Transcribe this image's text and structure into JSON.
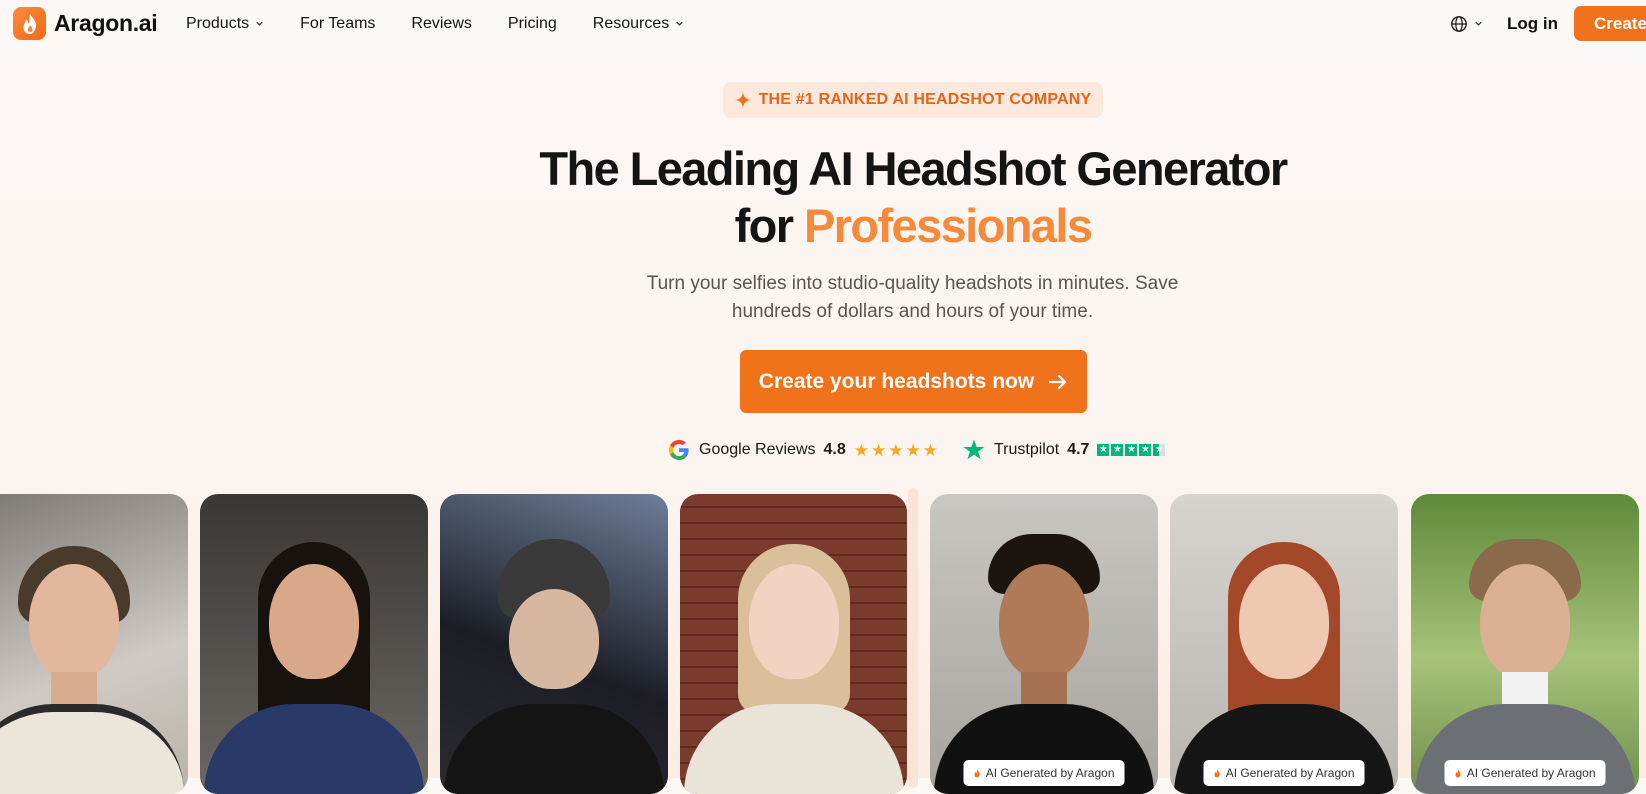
{
  "brand": {
    "name": "Aragon.ai",
    "color": "#f0731b",
    "accent_text": "#f58a3a"
  },
  "nav": {
    "items": [
      {
        "label": "Products",
        "dropdown": true
      },
      {
        "label": "For Teams",
        "dropdown": false
      },
      {
        "label": "Reviews",
        "dropdown": false
      },
      {
        "label": "Pricing",
        "dropdown": false
      },
      {
        "label": "Resources",
        "dropdown": true
      }
    ],
    "language_icon": "globe-icon",
    "login_label": "Log in",
    "create_label": "Create"
  },
  "hero": {
    "badge": "THE #1 RANKED AI HEADSHOT COMPANY",
    "title_line1": "The Leading AI Headshot Generator",
    "title_line2_prefix": "for ",
    "title_line2_accent": "Professionals",
    "subtitle": "Turn your selfies into studio-quality headshots in minutes. Save hundreds of dollars and hours of your time.",
    "cta_label": "Create your headshots now"
  },
  "ratings": [
    {
      "source": "Google Reviews",
      "score": "4.8",
      "icon": "google-icon",
      "stars": 5
    },
    {
      "source": "Trustpilot",
      "score": "4.7",
      "icon": "trustpilot-star-icon",
      "stars": 4.5
    }
  ],
  "gallery": {
    "ai_tag": "AI Generated by Aragon",
    "photos": [
      {
        "kind": "selfie",
        "subject": "man in cream jacket"
      },
      {
        "kind": "selfie",
        "subject": "woman with long dark hair"
      },
      {
        "kind": "selfie",
        "subject": "man in black beanie by river at night"
      },
      {
        "kind": "selfie",
        "subject": "woman in knit sweater by brick wall"
      },
      {
        "kind": "ai",
        "subject": "man in black shirt, arms crossed"
      },
      {
        "kind": "ai",
        "subject": "red-haired woman in black blazer"
      },
      {
        "kind": "ai",
        "subject": "man in grey suit outdoors"
      }
    ]
  }
}
